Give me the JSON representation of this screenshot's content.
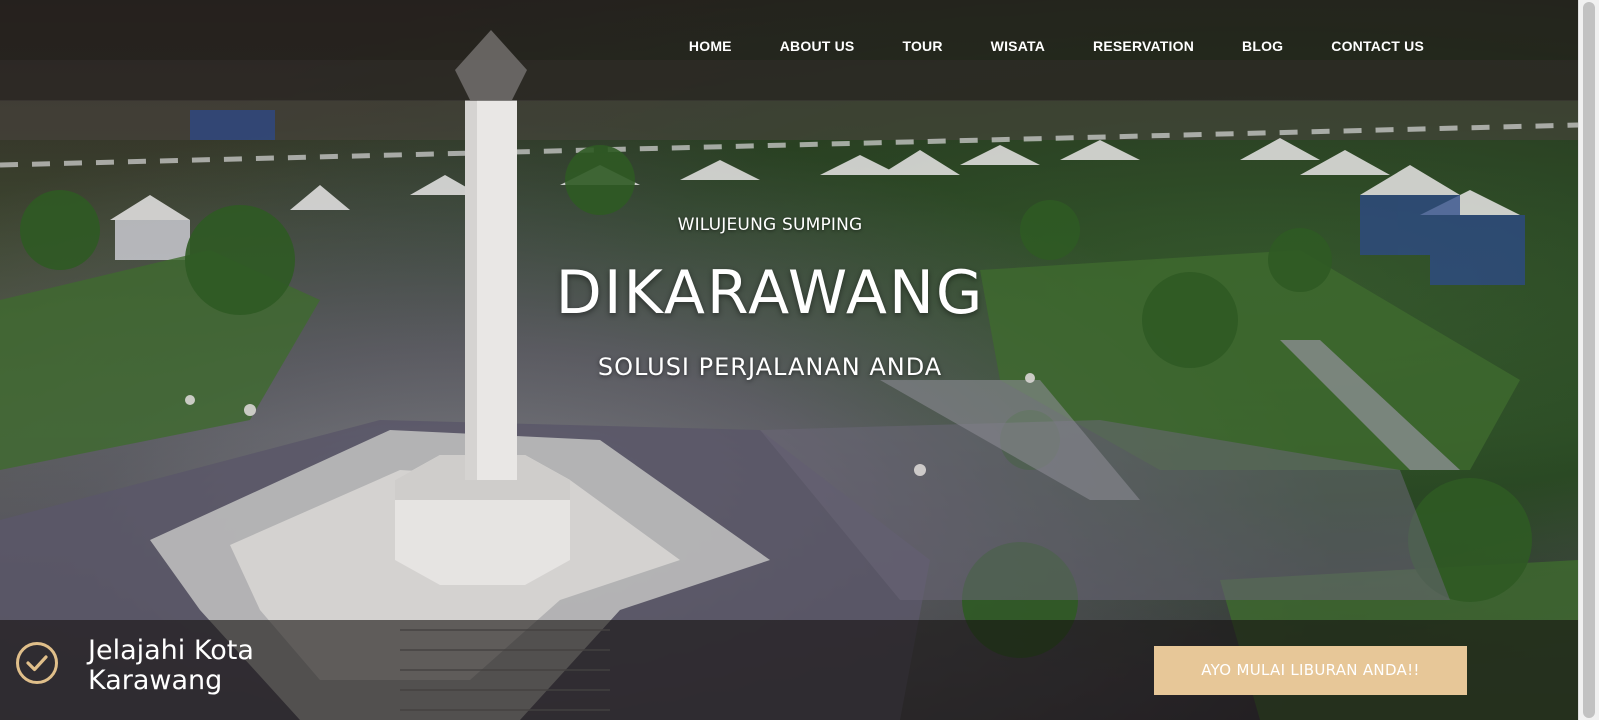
{
  "nav": {
    "items": [
      {
        "label": "HOME"
      },
      {
        "label": "ABOUT US"
      },
      {
        "label": "TOUR"
      },
      {
        "label": "WISATA"
      },
      {
        "label": "RESERVATION"
      },
      {
        "label": "BLOG"
      },
      {
        "label": "CONTACT US"
      }
    ]
  },
  "hero": {
    "greeting": "WILUJEUNG SUMPING",
    "title": "DIKARAWANG",
    "tagline": "SOLUSI PERJALANAN ANDA",
    "background": "aerial-city-park-monument-photo"
  },
  "bottom": {
    "icon": "check-circle-icon",
    "heading": "Jelajahi Kota Karawang",
    "cta_label": "AYO MULAI LIBURAN ANDA!!"
  },
  "colors": {
    "accent": "#e7c798",
    "check_icon": "#e0bf8a",
    "overlay": "#1e1a18"
  }
}
